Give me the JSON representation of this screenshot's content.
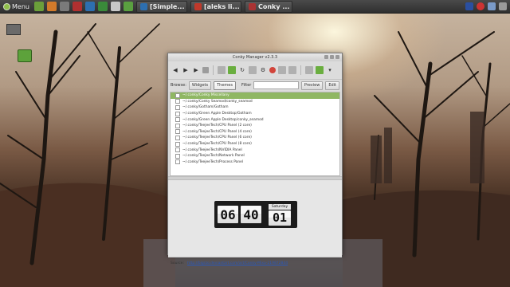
{
  "colors": {
    "selection": "#8fb763",
    "link": "#2a58b8",
    "panel": "#3a3a3a"
  },
  "panel": {
    "menu_label": "Menu",
    "tasks": [
      {
        "label": "[Simple...",
        "icon": "browser-icon"
      },
      {
        "label": "[aleks li...",
        "icon": "chat-icon"
      },
      {
        "label": "Conky ...",
        "icon": "conky-icon"
      }
    ]
  },
  "window": {
    "title": "Conky Manager v2.3.3",
    "browse_label": "Browse:",
    "widgets_btn": "Widgets",
    "themes_btn": "Themes",
    "filter_label": "Filter",
    "filter_value": "",
    "preview_btn": "Preview",
    "edit_btn": "Edit",
    "list": [
      "~/.conky/Conky Miscellany",
      "~/.conky/Conky Seamod/conky_seamod",
      "~/.conky/Gotham/Gotham",
      "~/.conky/Green Apple Desktop/Gotham",
      "~/.conky/Green Apple Desktop/conky_seamod",
      "~/.conky/TeejeeTech/CPU Panel (2 core)",
      "~/.conky/TeejeeTech/CPU Panel (4 core)",
      "~/.conky/TeejeeTech/CPU Panel (6 core)",
      "~/.conky/TeejeeTech/CPU Panel (8 core)",
      "~/.conky/TeejeeTech/NVIDIA Panel",
      "~/.conky/TeejeeTech/Network Panel",
      "~/.conky/TeejeeTech/Process Panel"
    ],
    "clock": {
      "hours": "06",
      "minutes": "40",
      "day": "Saturday",
      "date": "01"
    },
    "source_label": "Source:",
    "source_link": "http://bigrzo.deviantart.com/art/Conky-Mixa-219872844"
  }
}
